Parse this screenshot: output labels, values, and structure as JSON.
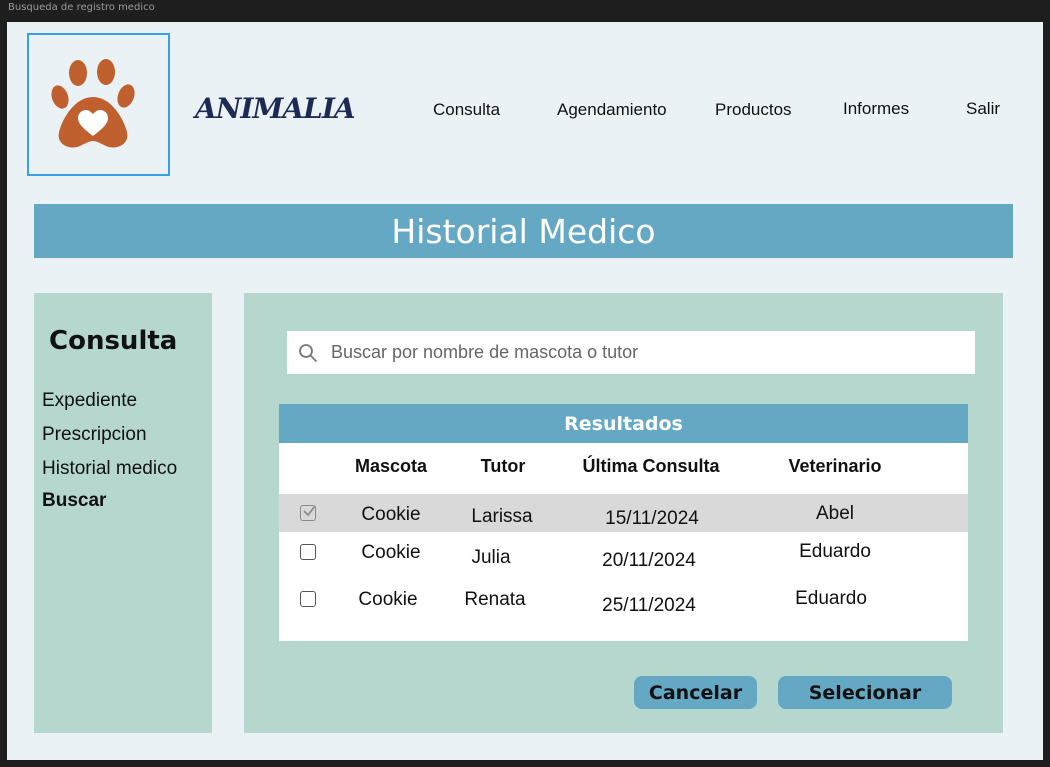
{
  "window": {
    "title": "Busqueda de registro medico"
  },
  "brand": {
    "name": "ANIMALIA",
    "logo_icon": "paw-heart-icon",
    "logo_color": "#c0602f"
  },
  "nav": {
    "items": [
      {
        "label": "Consulta"
      },
      {
        "label": "Agendamiento"
      },
      {
        "label": "Productos"
      },
      {
        "label": "Informes"
      },
      {
        "label": "Salir"
      }
    ]
  },
  "banner": {
    "title": "Historial Medico"
  },
  "sidebar": {
    "title": "Consulta",
    "items": [
      {
        "label": "Expediente"
      },
      {
        "label": "Prescripcion"
      },
      {
        "label": "Historial medico"
      },
      {
        "label": "Buscar",
        "active": true
      }
    ]
  },
  "search": {
    "placeholder": "Buscar por nombre de mascota o tutor",
    "icon": "search-icon"
  },
  "results": {
    "title": "Resultados",
    "columns": [
      "Mascota",
      "Tutor",
      "Última Consulta",
      "Veterinario"
    ],
    "rows": [
      {
        "selected": true,
        "mascota": "Cookie",
        "tutor": "Larissa",
        "fecha": "15/11/2024",
        "veterinario": "Abel"
      },
      {
        "selected": false,
        "mascota": "Cookie",
        "tutor": "Julia",
        "fecha": "20/11/2024",
        "veterinario": "Eduardo"
      },
      {
        "selected": false,
        "mascota": "Cookie",
        "tutor": "Renata",
        "fecha": "25/11/2024",
        "veterinario": "Eduardo"
      }
    ]
  },
  "actions": {
    "cancel_label": "Cancelar",
    "select_label": "Selecionar"
  },
  "colors": {
    "accent": "#64a8c4",
    "panel": "#b6d7cd",
    "background": "#ebf2f5",
    "selected_row": "#d9d9d9"
  }
}
